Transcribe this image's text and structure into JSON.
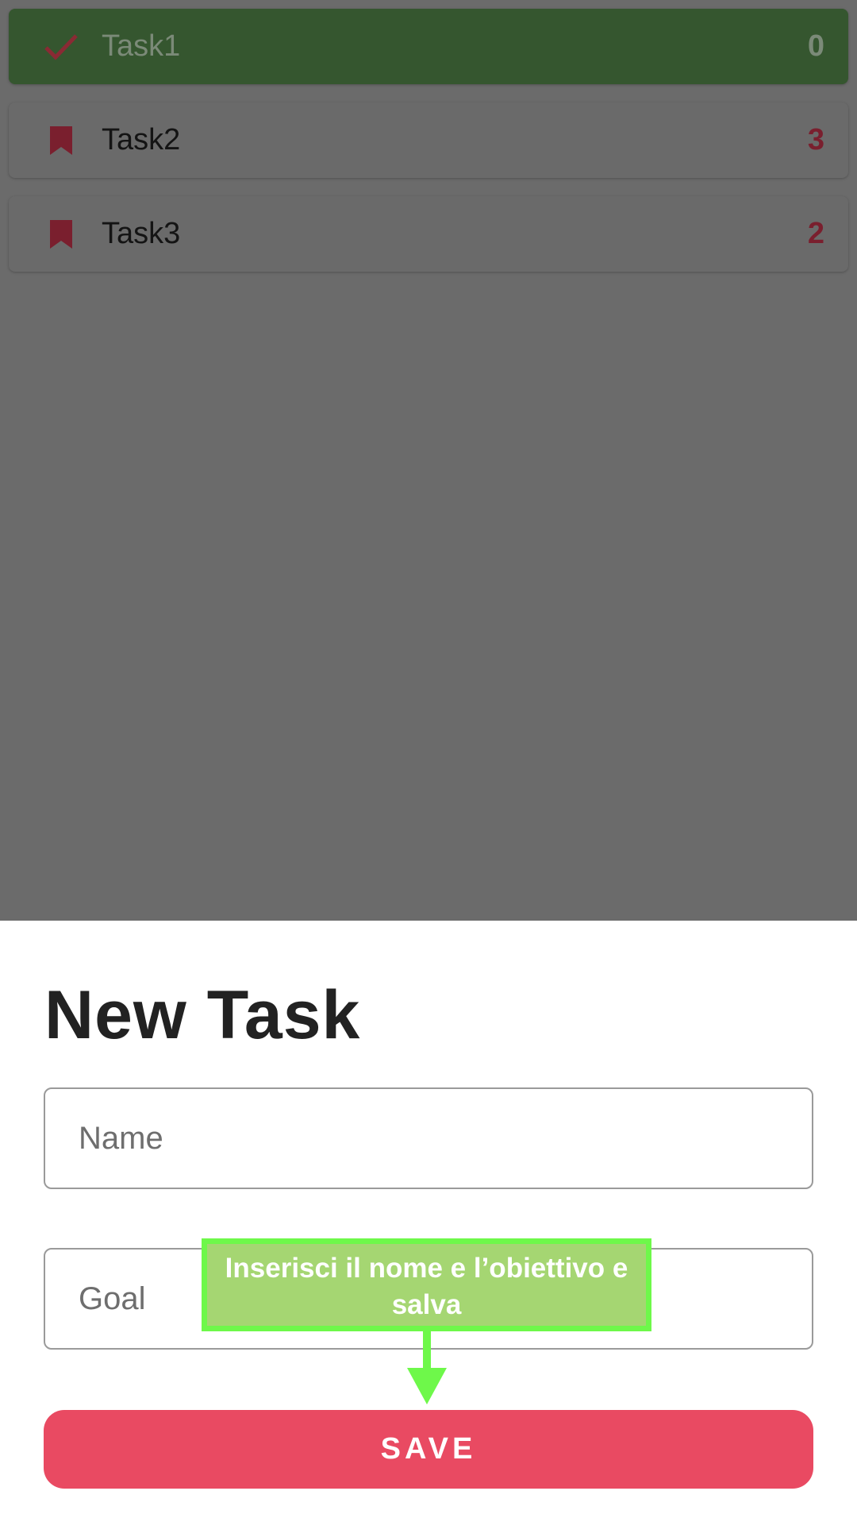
{
  "tasks": [
    {
      "name": "Task1",
      "count": "0",
      "status": "completed",
      "icon": "check-icon"
    },
    {
      "name": "Task2",
      "count": "3",
      "status": "pending",
      "icon": "bookmark-icon"
    },
    {
      "name": "Task3",
      "count": "2",
      "status": "pending",
      "icon": "bookmark-icon"
    }
  ],
  "sheet": {
    "title": "New Task",
    "name_placeholder": "Name",
    "goal_placeholder": "Goal",
    "save_label": "SAVE"
  },
  "annotation": {
    "text": "Inserisci il nome e l’obiettivo e salva"
  },
  "colors": {
    "accent": "#e94a62",
    "completed_card": "#35562f",
    "bookmark": "#7a1f2e",
    "annotation_border": "#6ef84a",
    "annotation_fill": "#a5d672"
  }
}
